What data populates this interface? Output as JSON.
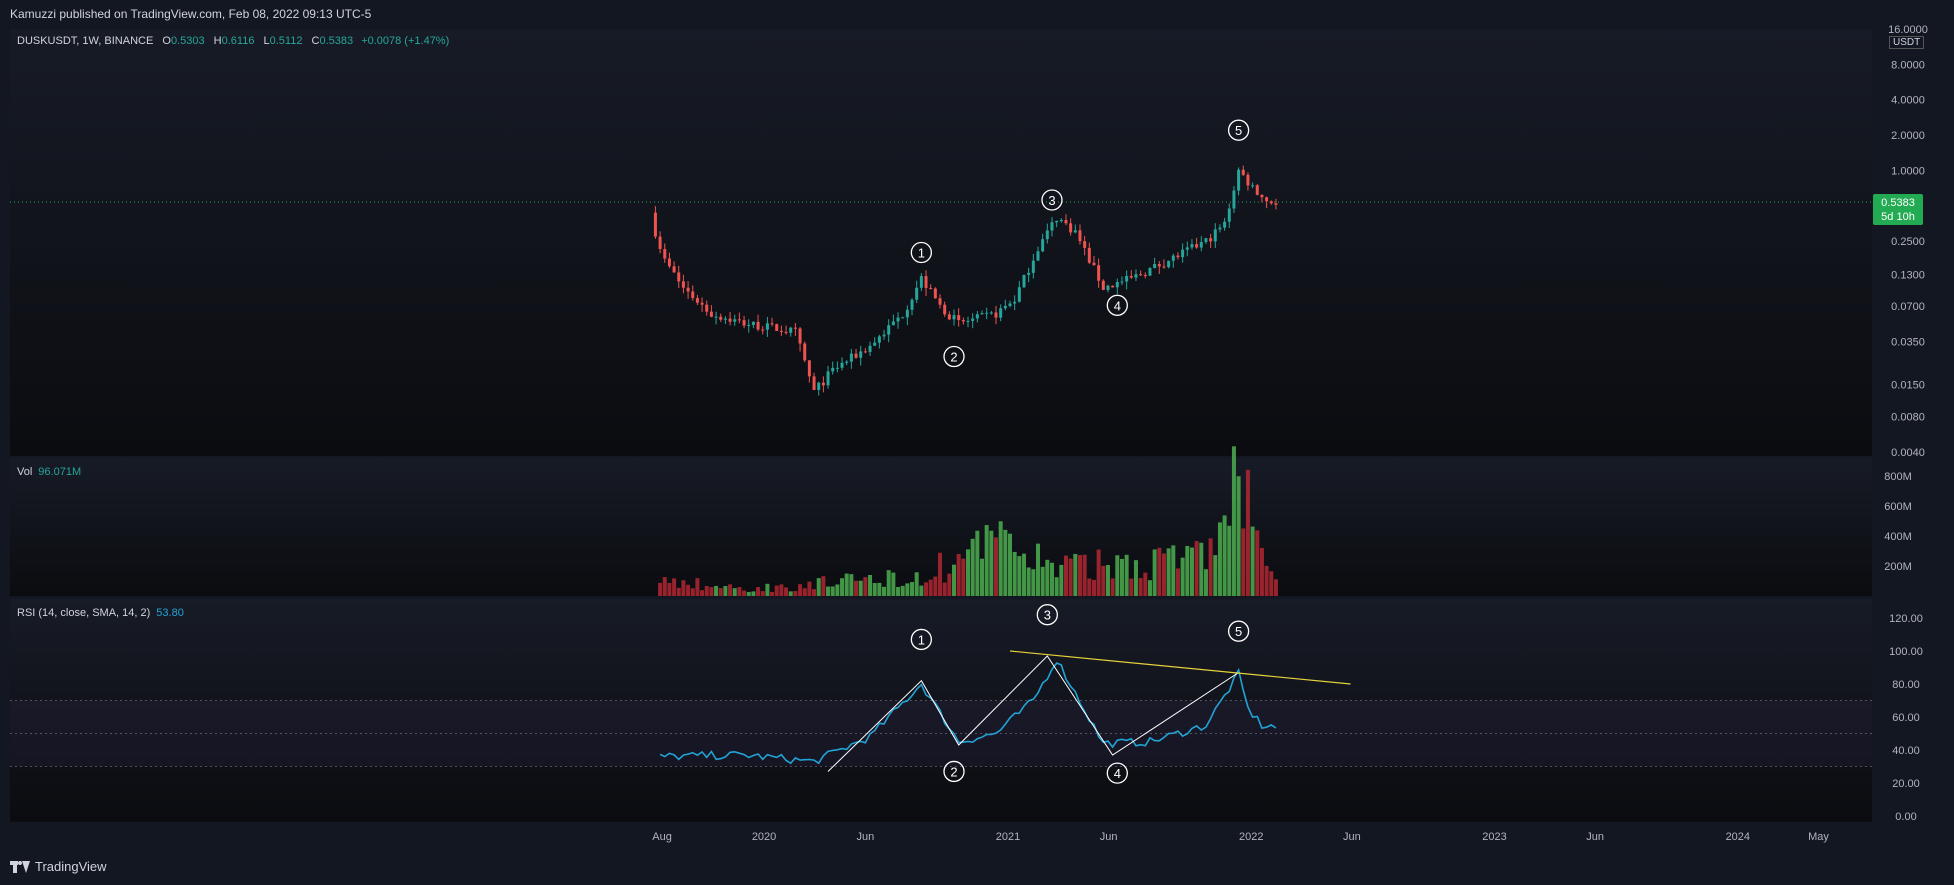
{
  "header": {
    "publish_line": "Kamuzzi published on TradingView.com, Feb 08, 2022 09:13 UTC-5"
  },
  "footer": {
    "brand": "TradingView"
  },
  "symbol_legend": {
    "symbol": "DUSKUSDT, 1W, BINANCE",
    "open_label": "O",
    "open": "0.5303",
    "high_label": "H",
    "high": "0.6116",
    "low_label": "L",
    "low": "0.5112",
    "close_label": "C",
    "close": "0.5383",
    "change": "+0.0078 (+1.47%)"
  },
  "volume_legend": {
    "label": "Vol",
    "value": "96.071M"
  },
  "rsi_legend": {
    "label": "RSI (14, close, SMA, 14, 2)",
    "value": "53.80"
  },
  "price_scale": {
    "currency": "USDT",
    "last_price": "0.5383",
    "countdown": "5d 10h"
  },
  "colors": {
    "background": "#131722",
    "up": "#26a69a",
    "down": "#ef5350",
    "volume_up": "#4caf50",
    "volume_down": "#b22833",
    "rsi_line": "#22a3d6",
    "trend_line": "#e6d23c",
    "wave_line": "#ffffff",
    "last_price_tag": "#22ab52"
  },
  "chart_data": {
    "type": "candlestick",
    "scale": "log",
    "time_axis_labels": [
      "Aug",
      "2020",
      "Jun",
      "2021",
      "Jun",
      "2022",
      "Jun",
      "2023",
      "Jun",
      "2024",
      "May"
    ],
    "price_axis_ticks": [
      "16.0000",
      "8.0000",
      "4.0000",
      "2.0000",
      "1.0000",
      "0.2500",
      "0.1300",
      "0.0700",
      "0.0350",
      "0.0150",
      "0.0080",
      "0.0040"
    ],
    "volume_axis_ticks": [
      "800M",
      "600M",
      "400M",
      "200M"
    ],
    "rsi_axis_ticks": [
      "120.00",
      "100.00",
      "80.00",
      "60.00",
      "40.00",
      "20.00",
      "0.00"
    ],
    "rsi_bands": {
      "upper": 70,
      "middle": 50,
      "lower": 30
    },
    "price_wave_labels": [
      "1",
      "2",
      "3",
      "4",
      "5"
    ],
    "rsi_wave_labels": [
      "1",
      "2",
      "3",
      "4",
      "5"
    ],
    "price_anchor_points": [
      {
        "date": "2019-07-22",
        "price": 0.3
      },
      {
        "date": "2019-08-05",
        "price": 0.17
      },
      {
        "date": "2019-09-02",
        "price": 0.1
      },
      {
        "date": "2019-10-14",
        "price": 0.06
      },
      {
        "date": "2019-12-02",
        "price": 0.05
      },
      {
        "date": "2020-01-20",
        "price": 0.045
      },
      {
        "date": "2020-02-17",
        "price": 0.042
      },
      {
        "date": "2020-03-16",
        "price": 0.013
      },
      {
        "date": "2020-04-13",
        "price": 0.02
      },
      {
        "date": "2020-06-08",
        "price": 0.032
      },
      {
        "date": "2020-07-27",
        "price": 0.06
      },
      {
        "date": "2020-08-24",
        "price": 0.12
      },
      {
        "date": "2020-09-21",
        "price": 0.07
      },
      {
        "date": "2020-10-19",
        "price": 0.05
      },
      {
        "date": "2020-12-14",
        "price": 0.06
      },
      {
        "date": "2021-01-11",
        "price": 0.08
      },
      {
        "date": "2021-02-15",
        "price": 0.22
      },
      {
        "date": "2021-03-15",
        "price": 0.4
      },
      {
        "date": "2021-04-12",
        "price": 0.3
      },
      {
        "date": "2021-05-24",
        "price": 0.1
      },
      {
        "date": "2021-07-05",
        "price": 0.12
      },
      {
        "date": "2021-09-06",
        "price": 0.18
      },
      {
        "date": "2021-10-25",
        "price": 0.25
      },
      {
        "date": "2021-11-22",
        "price": 0.35
      },
      {
        "date": "2021-12-13",
        "price": 1.0
      },
      {
        "date": "2021-12-27",
        "price": 0.8
      },
      {
        "date": "2022-01-24",
        "price": 0.55
      },
      {
        "date": "2022-02-07",
        "price": 0.5383
      }
    ],
    "rsi_anchor_points": [
      {
        "date": "2019-07-29",
        "rsi": 36
      },
      {
        "date": "2019-12-02",
        "rsi": 37
      },
      {
        "date": "2020-03-16",
        "rsi": 33
      },
      {
        "date": "2020-06-08",
        "rsi": 48
      },
      {
        "date": "2020-08-24",
        "rsi": 80
      },
      {
        "date": "2020-10-19",
        "rsi": 45
      },
      {
        "date": "2020-12-14",
        "rsi": 50
      },
      {
        "date": "2021-02-08",
        "rsi": 70
      },
      {
        "date": "2021-03-15",
        "rsi": 95
      },
      {
        "date": "2021-05-24",
        "rsi": 44
      },
      {
        "date": "2021-08-02",
        "rsi": 45
      },
      {
        "date": "2021-10-25",
        "rsi": 55
      },
      {
        "date": "2021-12-13",
        "rsi": 86
      },
      {
        "date": "2021-12-27",
        "rsi": 65
      },
      {
        "date": "2022-01-17",
        "rsi": 55
      },
      {
        "date": "2022-02-07",
        "rsi": 53.8
      }
    ],
    "volume_anchor_points": [
      {
        "date": "2019-07-29",
        "volume": 120000000
      },
      {
        "date": "2019-12-02",
        "volume": 50000000
      },
      {
        "date": "2020-08-24",
        "volume": 150000000
      },
      {
        "date": "2021-01-04",
        "volume": 420000000
      },
      {
        "date": "2021-03-15",
        "volume": 200000000
      },
      {
        "date": "2021-10-25",
        "volume": 300000000
      },
      {
        "date": "2021-12-13",
        "volume": 820000000
      },
      {
        "date": "2022-01-10",
        "volume": 500000000
      },
      {
        "date": "2022-02-07",
        "volume": 96071000
      }
    ],
    "rsi_wave_points": [
      {
        "label": "",
        "date": "2020-04-06",
        "rsi": 27
      },
      {
        "label": "1",
        "date": "2020-08-24",
        "rsi": 82
      },
      {
        "label": "2",
        "date": "2020-10-19",
        "rsi": 43
      },
      {
        "label": "3",
        "date": "2021-03-01",
        "rsi": 97
      },
      {
        "label": "4",
        "date": "2021-06-07",
        "rsi": 37
      },
      {
        "label": "5",
        "date": "2021-12-13",
        "rsi": 87
      }
    ],
    "rsi_trendline": [
      {
        "date": "2021-01-04",
        "rsi": 100
      },
      {
        "date": "2022-05-30",
        "rsi": 80
      }
    ]
  }
}
